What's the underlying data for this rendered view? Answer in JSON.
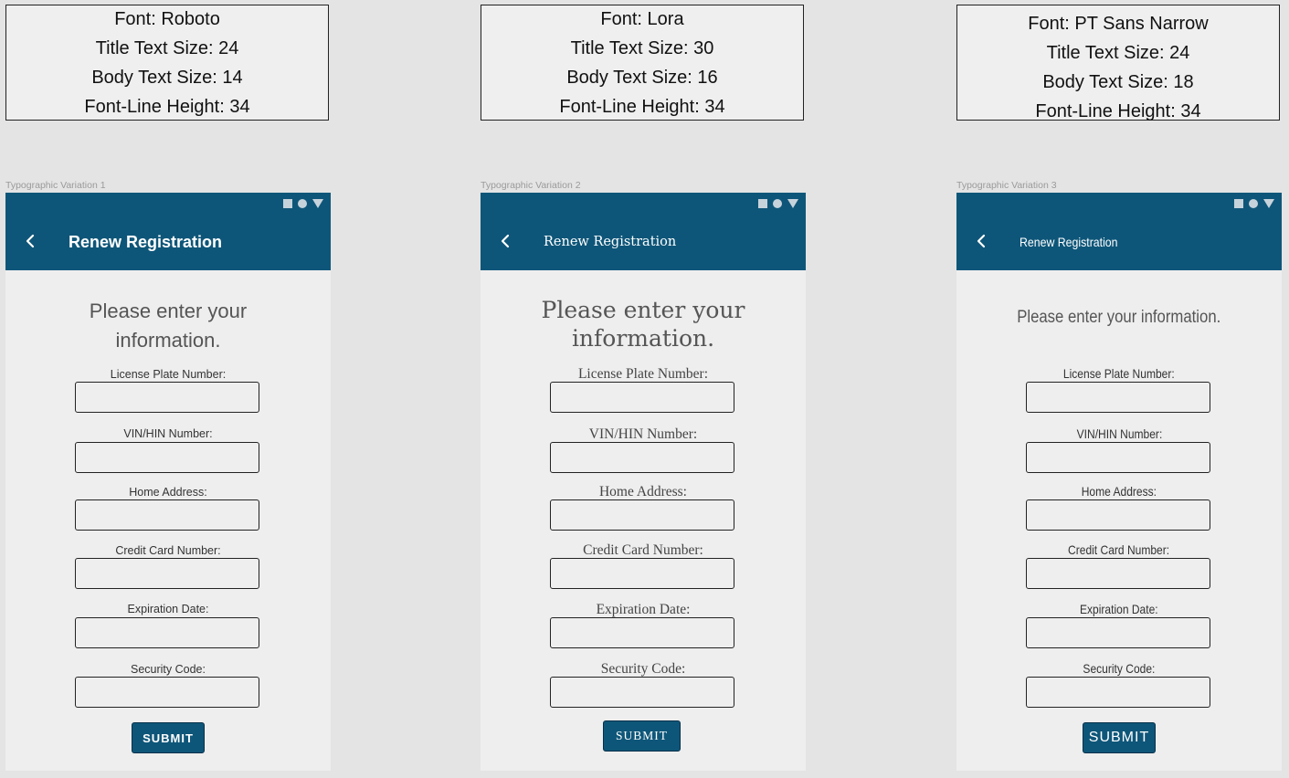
{
  "variations": [
    {
      "spec": {
        "font": "Font: Roboto",
        "title_size": "Title Text Size: 24",
        "body_size": "Body Text Size: 14",
        "line_height": "Font-Line Height: 34"
      },
      "frame_label": "Typographic Variation 1",
      "appbar": {
        "back_icon": "chevron-left-icon",
        "title": "Renew Registration"
      },
      "status_icons": [
        "square-icon",
        "circle-icon",
        "triangle-icon"
      ],
      "heading": "Please enter your information.",
      "fields": [
        {
          "label": "License Plate Number:",
          "value": ""
        },
        {
          "label": "VIN/HIN Number:",
          "value": ""
        },
        {
          "label": "Home Address:",
          "value": ""
        },
        {
          "label": "Credit Card Number:",
          "value": ""
        },
        {
          "label": "Expiration Date:",
          "value": ""
        },
        {
          "label": "Security Code:",
          "value": ""
        }
      ],
      "submit_label": "SUBMIT"
    },
    {
      "spec": {
        "font": "Font: Lora",
        "title_size": "Title Text Size: 30",
        "body_size": "Body Text Size: 16",
        "line_height": "Font-Line Height: 34"
      },
      "frame_label": "Typographic Variation 2",
      "appbar": {
        "back_icon": "chevron-left-icon",
        "title": "Renew Registration"
      },
      "status_icons": [
        "square-icon",
        "circle-icon",
        "triangle-icon"
      ],
      "heading": "Please enter your information.",
      "fields": [
        {
          "label": "License Plate Number:",
          "value": ""
        },
        {
          "label": "VIN/HIN Number:",
          "value": ""
        },
        {
          "label": "Home Address:",
          "value": ""
        },
        {
          "label": "Credit Card Number:",
          "value": ""
        },
        {
          "label": "Expiration Date:",
          "value": ""
        },
        {
          "label": "Security Code:",
          "value": ""
        }
      ],
      "submit_label": "SUBMIT"
    },
    {
      "spec": {
        "font": "Font: PT Sans Narrow",
        "title_size": "Title Text Size: 24",
        "body_size": "Body Text Size: 18",
        "line_height": "Font-Line Height: 34"
      },
      "frame_label": "Typographic Variation 3",
      "appbar": {
        "back_icon": "chevron-left-icon",
        "title": "Renew Registration"
      },
      "status_icons": [
        "square-icon",
        "circle-icon",
        "triangle-icon"
      ],
      "heading": "Please enter your information.",
      "fields": [
        {
          "label": "License Plate Number:",
          "value": ""
        },
        {
          "label": "VIN/HIN Number:",
          "value": ""
        },
        {
          "label": "Home Address:",
          "value": ""
        },
        {
          "label": "Credit Card Number:",
          "value": ""
        },
        {
          "label": "Expiration Date:",
          "value": ""
        },
        {
          "label": "Security Code:",
          "value": ""
        }
      ],
      "submit_label": "SUBMIT"
    }
  ],
  "colors": {
    "appbar": "#0e5679",
    "canvas": "#e4e4e4",
    "phone_bg": "#eeeeee",
    "submit_border": "#07304a"
  }
}
